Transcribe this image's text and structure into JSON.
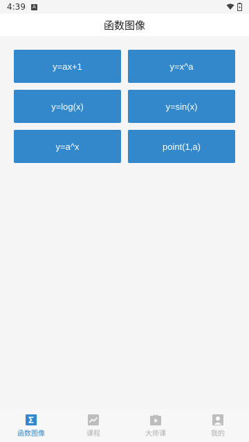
{
  "status_bar": {
    "time": "4:39",
    "notification_glyph": "A",
    "icons": [
      "wifi-icon",
      "battery-icon"
    ]
  },
  "header": {
    "title": "函数图像"
  },
  "functions": [
    {
      "label": "y=ax+1"
    },
    {
      "label": "y=x^a"
    },
    {
      "label": "y=log(x)"
    },
    {
      "label": "y=sin(x)"
    },
    {
      "label": "y=a^x"
    },
    {
      "label": "point(1,a)"
    }
  ],
  "tabbar": {
    "tabs": [
      {
        "label": "函数图像",
        "icon": "sigma-icon",
        "active": true
      },
      {
        "label": "课程",
        "icon": "chart-icon",
        "active": false
      },
      {
        "label": "大师课",
        "icon": "video-icon",
        "active": false
      },
      {
        "label": "我的",
        "icon": "user-icon",
        "active": false
      }
    ]
  },
  "colors": {
    "accent": "#3388cc",
    "inactive": "#b0b0b0",
    "background": "#f5f5f5"
  }
}
